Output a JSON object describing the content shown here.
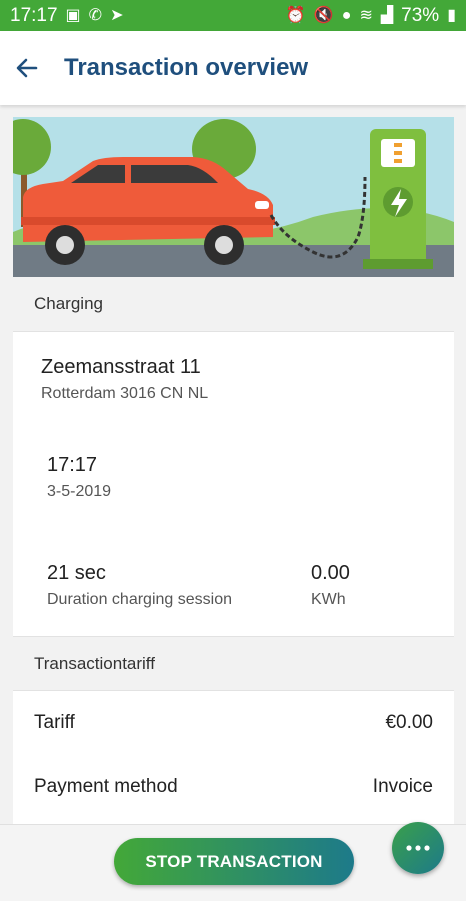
{
  "status_bar": {
    "time": "17:17",
    "battery": "73%",
    "left_icons": [
      "image-icon",
      "phone-icon",
      "navigation-icon"
    ],
    "right_icons": [
      "alarm-icon",
      "mute-icon",
      "location-icon",
      "wifi-icon",
      "signal-icon",
      "battery-icon"
    ]
  },
  "header": {
    "title": "Transaction overview",
    "back_icon": "arrow-left-icon"
  },
  "charging": {
    "section_label": "Charging",
    "address_line1": "Zeemansstraat 11",
    "address_line2": "Rotterdam 3016 CN NL",
    "time": "17:17",
    "date": "3-5-2019",
    "duration_value": "21 sec",
    "duration_label": "Duration charging session",
    "energy_value": "0.00",
    "energy_unit": "KWh"
  },
  "tariff": {
    "section_label": "Transactiontariff",
    "tariff_label": "Tariff",
    "tariff_value": "€0.00",
    "payment_label": "Payment method",
    "payment_value": "Invoice"
  },
  "actions": {
    "stop_label": "STOP TRANSACTION",
    "more_icon": "more-horizontal-icon"
  },
  "colors": {
    "status_bar": "#43a838",
    "title": "#1f4f7d",
    "car": "#ef5b3a",
    "charger": "#7fbf3f"
  }
}
